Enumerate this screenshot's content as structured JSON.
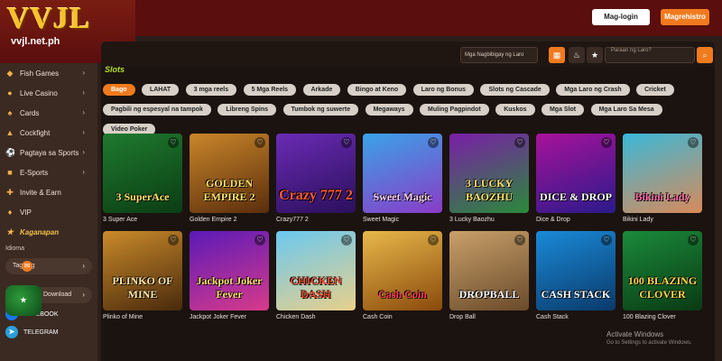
{
  "header": {
    "logo": "VVJL",
    "url": "vvjl.net.ph",
    "login_label": "Mag-login",
    "register_label": "Magrehistro"
  },
  "sidebar": {
    "items": [
      {
        "label": "Fish Games",
        "icon": "fish-icon"
      },
      {
        "label": "Live Casino",
        "icon": "casino-icon"
      },
      {
        "label": "Cards",
        "icon": "cards-icon"
      },
      {
        "label": "Cockfight",
        "icon": "rooster-icon"
      },
      {
        "label": "Pagtaya sa Sports",
        "icon": "sports-icon"
      },
      {
        "label": "E-Sports",
        "icon": "esports-icon"
      },
      {
        "label": "Invite & Earn",
        "icon": "invite-icon"
      },
      {
        "label": "VIP",
        "icon": "vip-icon"
      },
      {
        "label": "Kaganapan",
        "icon": "event-icon"
      }
    ],
    "language_label": "Idioma",
    "language_value": "Tagalog",
    "download_label": "Download",
    "facebook_label": "FACEBOOK",
    "telegram_label": "TELEGRAM"
  },
  "main": {
    "section_title": "Slots",
    "provider_select": "Mga Nagbibigay ng Laro",
    "search_placeholder": "Paraan ng Laro?"
  },
  "tags": [
    "Bago",
    "LAHAT",
    "3 mga reels",
    "5 Mga Reels",
    "Arkade",
    "Bingo at Keno",
    "Laro ng Bonus",
    "Slots ng Cascade",
    "Mga Laro ng Crash",
    "Cricket",
    "Pagbili ng espesyal na tampok",
    "Libreng Spins",
    "Tumbok ng suwerte",
    "Megaways",
    "Muling Pagpindot",
    "Kuskos",
    "Mga Slot",
    "Mga Laro Sa Mesa",
    "Video Poker"
  ],
  "active_tag": "Bago",
  "games": [
    {
      "name": "3 Super Ace",
      "art": "3 SuperAce"
    },
    {
      "name": "Golden Empire 2",
      "art": "GOLDEN EMPIRE 2"
    },
    {
      "name": "Crazy777 2",
      "art": "Crazy 777 2"
    },
    {
      "name": "Sweet Magic",
      "art": "Sweet Magic"
    },
    {
      "name": "3 Lucky Baozhu",
      "art": "3 LUCKY BAOZHU"
    },
    {
      "name": "Dice & Drop",
      "art": "DICE & DROP"
    },
    {
      "name": "Bikini Lady",
      "art": "Bikini Lady"
    },
    {
      "name": "Plinko of Mine",
      "art": "PLINKO OF MINE"
    },
    {
      "name": "Jackpot Joker Fever",
      "art": "Jackpot Joker Fever"
    },
    {
      "name": "Chicken Dash",
      "art": "CHICKEN DASH"
    },
    {
      "name": "Cash Coin",
      "art": "Cash Coin"
    },
    {
      "name": "Drop Ball",
      "art": "DROPBALL"
    },
    {
      "name": "Cash Stack",
      "art": "CASH STACK"
    },
    {
      "name": "100 Blazing Clover",
      "art": "100 BLAZING CLOVER"
    }
  ],
  "watermark": {
    "title": "Activate Windows",
    "subtitle": "Go to Settings to activate Windows."
  }
}
